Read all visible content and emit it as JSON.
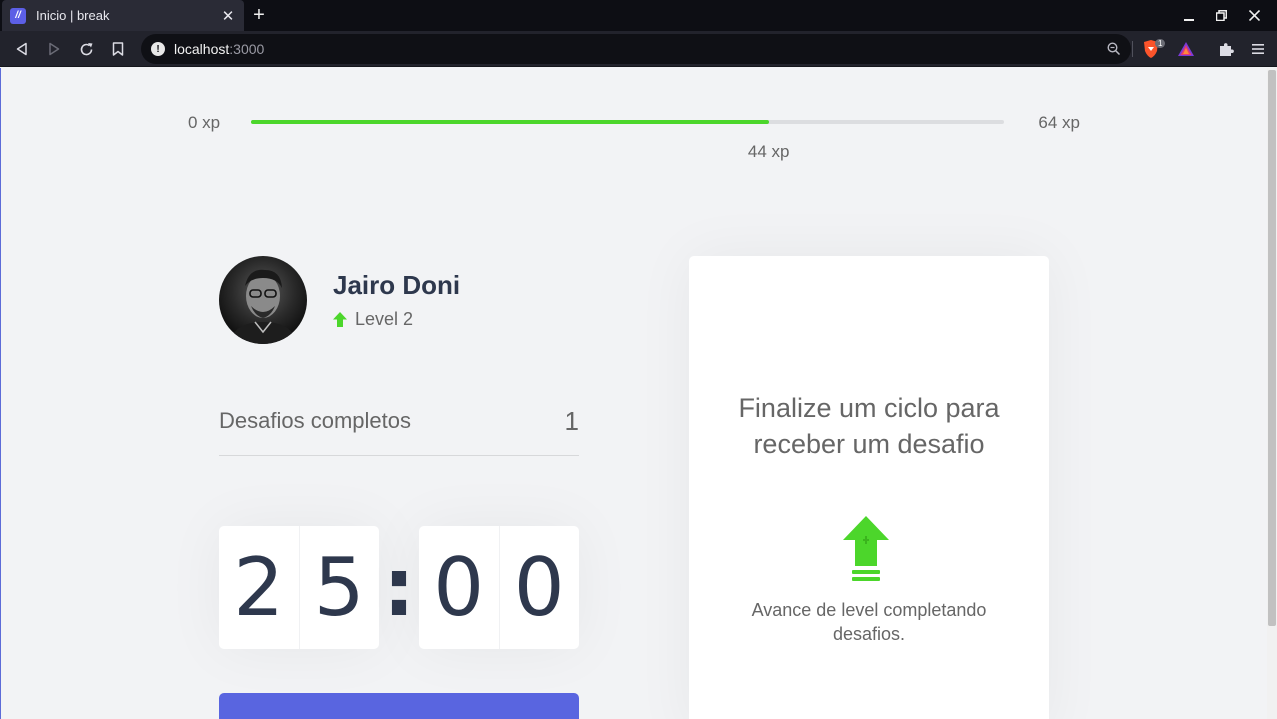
{
  "browser": {
    "tab_title": "Inicio | break",
    "url_host": "localhost",
    "url_port": ":3000",
    "extension_badge": "1",
    "accent": "#5c5fe6"
  },
  "xp": {
    "min_label": "0 xp",
    "max_label": "64 xp",
    "current_label": "44 xp",
    "current": 44,
    "max": 64,
    "fill_color": "#4cd62b"
  },
  "profile": {
    "name": "Jairo Doni",
    "level": "Level 2"
  },
  "completed": {
    "label": "Desafios completos",
    "count": "1"
  },
  "countdown": {
    "minute_left": "2",
    "minute_right": "5",
    "separator": ":",
    "second_left": "0",
    "second_right": "0"
  },
  "start_button": {
    "color": "#5965e0"
  },
  "challenge": {
    "title": "Finalize um ciclo para receber um desafio",
    "subtitle": "Avance de level completando desafios.",
    "icon": "level-up-icon"
  }
}
